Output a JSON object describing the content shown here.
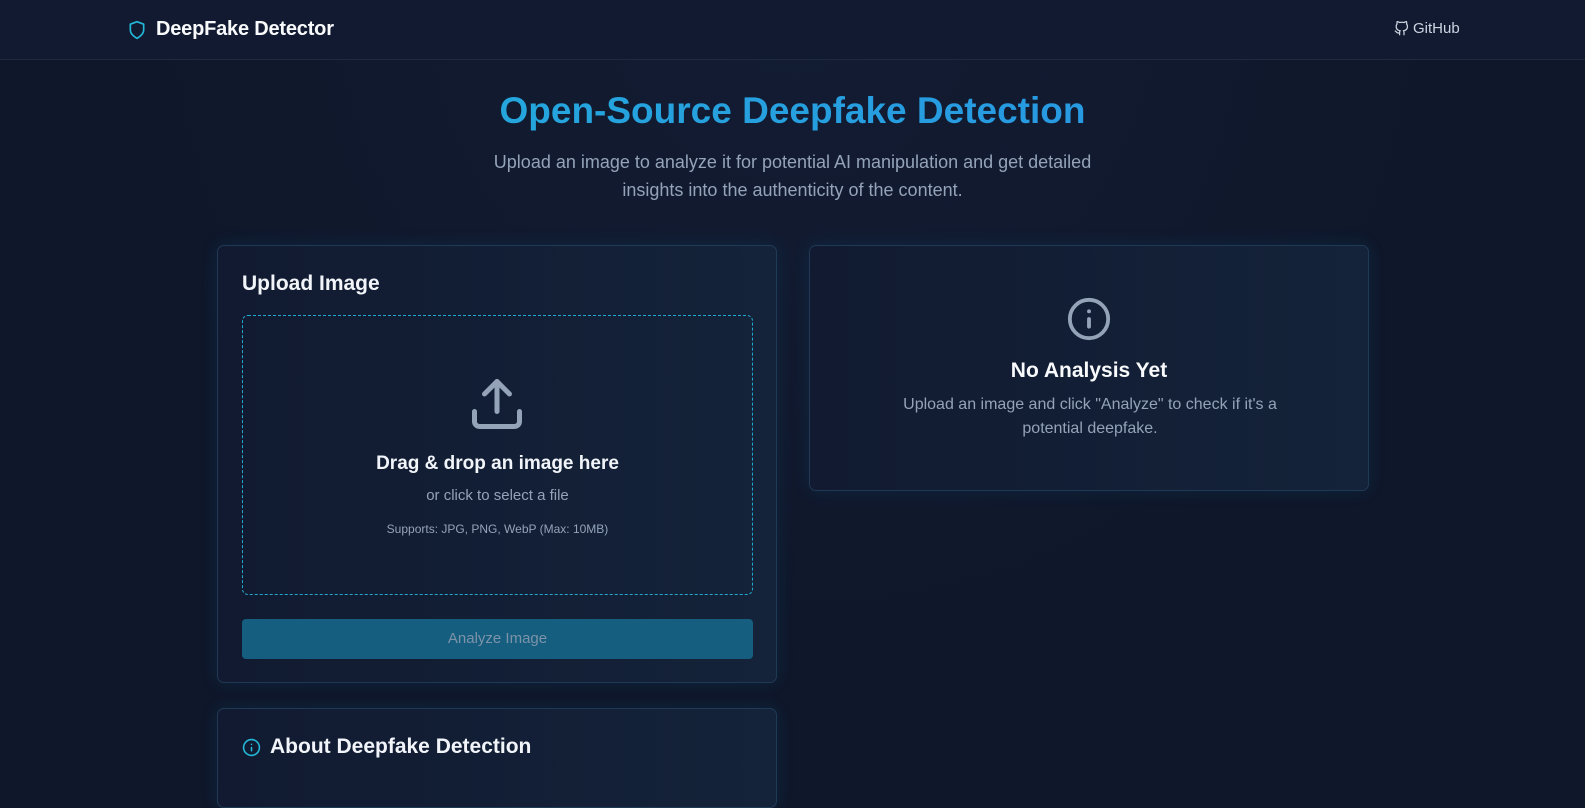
{
  "navbar": {
    "brand_title": "DeepFake Detector",
    "brand_icon": "shield-icon",
    "github_label": "GitHub",
    "github_icon": "github-icon"
  },
  "hero": {
    "title": "Open-Source Deepfake Detection",
    "subtitle": "Upload an image to analyze it for potential AI manipulation and get detailed insights into the authenticity of the content."
  },
  "upload": {
    "title": "Upload Image",
    "icon": "upload-icon",
    "drop_title": "Drag & drop an image here",
    "drop_sub": "or click to select a file",
    "supports": "Supports: JPG, PNG, WebP (Max: 10MB)",
    "analyze_label": "Analyze Image"
  },
  "result": {
    "icon": "info-icon",
    "title": "No Analysis Yet",
    "description": "Upload an image and click \"Analyze\" to check if it's a potential deepfake."
  },
  "about": {
    "icon": "info-icon",
    "title": "About Deepfake Detection"
  },
  "colors": {
    "background": "#0f172a",
    "navbar": "#111a30",
    "accent": "#22b0d8",
    "accent_blue": "#2a8fe6",
    "button": "#155e80",
    "muted_text": "#94a3b8"
  }
}
